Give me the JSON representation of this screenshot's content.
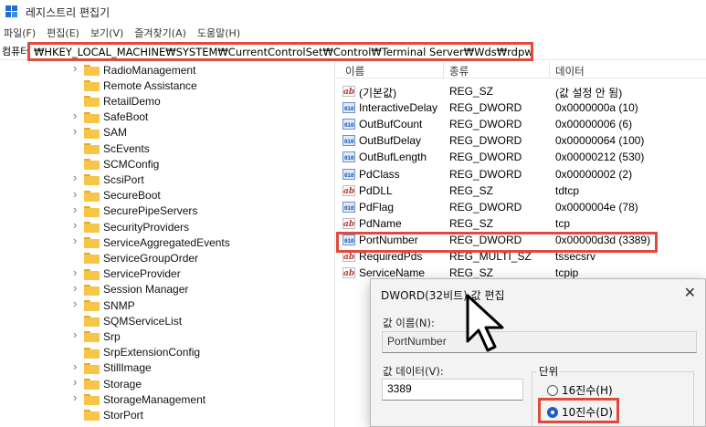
{
  "window": {
    "title": "레지스트리 편집기"
  },
  "menu": [
    "파일(F)",
    "편집(E)",
    "보기(V)",
    "즐겨찾기(A)",
    "도움말(H)"
  ],
  "address": {
    "label": "컴퓨터",
    "path": "₩HKEY_LOCAL_MACHINE₩SYSTEM₩CurrentControlSet₩Control₩Terminal Server₩Wds₩rdpwd₩Tds₩tcp"
  },
  "tree": {
    "items": [
      {
        "label": "RadioManagement",
        "expandable": true
      },
      {
        "label": "Remote Assistance",
        "expandable": false
      },
      {
        "label": "RetailDemo",
        "expandable": false
      },
      {
        "label": "SafeBoot",
        "expandable": true
      },
      {
        "label": "SAM",
        "expandable": true
      },
      {
        "label": "ScEvents",
        "expandable": false
      },
      {
        "label": "SCMConfig",
        "expandable": false
      },
      {
        "label": "ScsiPort",
        "expandable": true
      },
      {
        "label": "SecureBoot",
        "expandable": true
      },
      {
        "label": "SecurePipeServers",
        "expandable": true
      },
      {
        "label": "SecurityProviders",
        "expandable": true
      },
      {
        "label": "ServiceAggregatedEvents",
        "expandable": true
      },
      {
        "label": "ServiceGroupOrder",
        "expandable": false
      },
      {
        "label": "ServiceProvider",
        "expandable": true
      },
      {
        "label": "Session Manager",
        "expandable": true
      },
      {
        "label": "SNMP",
        "expandable": true
      },
      {
        "label": "SQMServiceList",
        "expandable": false
      },
      {
        "label": "Srp",
        "expandable": true
      },
      {
        "label": "SrpExtensionConfig",
        "expandable": false
      },
      {
        "label": "StillImage",
        "expandable": true
      },
      {
        "label": "Storage",
        "expandable": true
      },
      {
        "label": "StorageManagement",
        "expandable": true
      },
      {
        "label": "StorPort",
        "expandable": false
      }
    ]
  },
  "list": {
    "headers": {
      "name": "이름",
      "type": "종류",
      "data": "데이터"
    },
    "rows": [
      {
        "icon": "ab",
        "name": "(기본값)",
        "type": "REG_SZ",
        "data": "(값 설정 안 됨)"
      },
      {
        "icon": "bin",
        "name": "InteractiveDelay",
        "type": "REG_DWORD",
        "data": "0x0000000a (10)"
      },
      {
        "icon": "bin",
        "name": "OutBufCount",
        "type": "REG_DWORD",
        "data": "0x00000006 (6)"
      },
      {
        "icon": "bin",
        "name": "OutBufDelay",
        "type": "REG_DWORD",
        "data": "0x00000064 (100)"
      },
      {
        "icon": "bin",
        "name": "OutBufLength",
        "type": "REG_DWORD",
        "data": "0x00000212 (530)"
      },
      {
        "icon": "bin",
        "name": "PdClass",
        "type": "REG_DWORD",
        "data": "0x00000002 (2)"
      },
      {
        "icon": "ab",
        "name": "PdDLL",
        "type": "REG_SZ",
        "data": "tdtcp"
      },
      {
        "icon": "bin",
        "name": "PdFlag",
        "type": "REG_DWORD",
        "data": "0x0000004e (78)"
      },
      {
        "icon": "ab",
        "name": "PdName",
        "type": "REG_SZ",
        "data": "tcp"
      },
      {
        "icon": "bin",
        "name": "PortNumber",
        "type": "REG_DWORD",
        "data": "0x00000d3d (3389)"
      },
      {
        "icon": "ab",
        "name": "RequiredPds",
        "type": "REG_MULTI_SZ",
        "data": "tssecsrv"
      },
      {
        "icon": "ab",
        "name": "ServiceName",
        "type": "REG_SZ",
        "data": "tcpip"
      }
    ]
  },
  "dialog": {
    "title": "DWORD(32비트) 값 편집",
    "value_name_label": "값 이름(N):",
    "value_name": "PortNumber",
    "value_data_label": "값 데이터(V):",
    "value_data": "3389",
    "base_label": "단위",
    "radio_hex": "16진수(H)",
    "radio_dec": "10진수(D)",
    "selected_base": "dec"
  },
  "colors": {
    "highlight": "#e04a3a",
    "folder": "#f7c548",
    "accent": "#1f5fbf"
  }
}
